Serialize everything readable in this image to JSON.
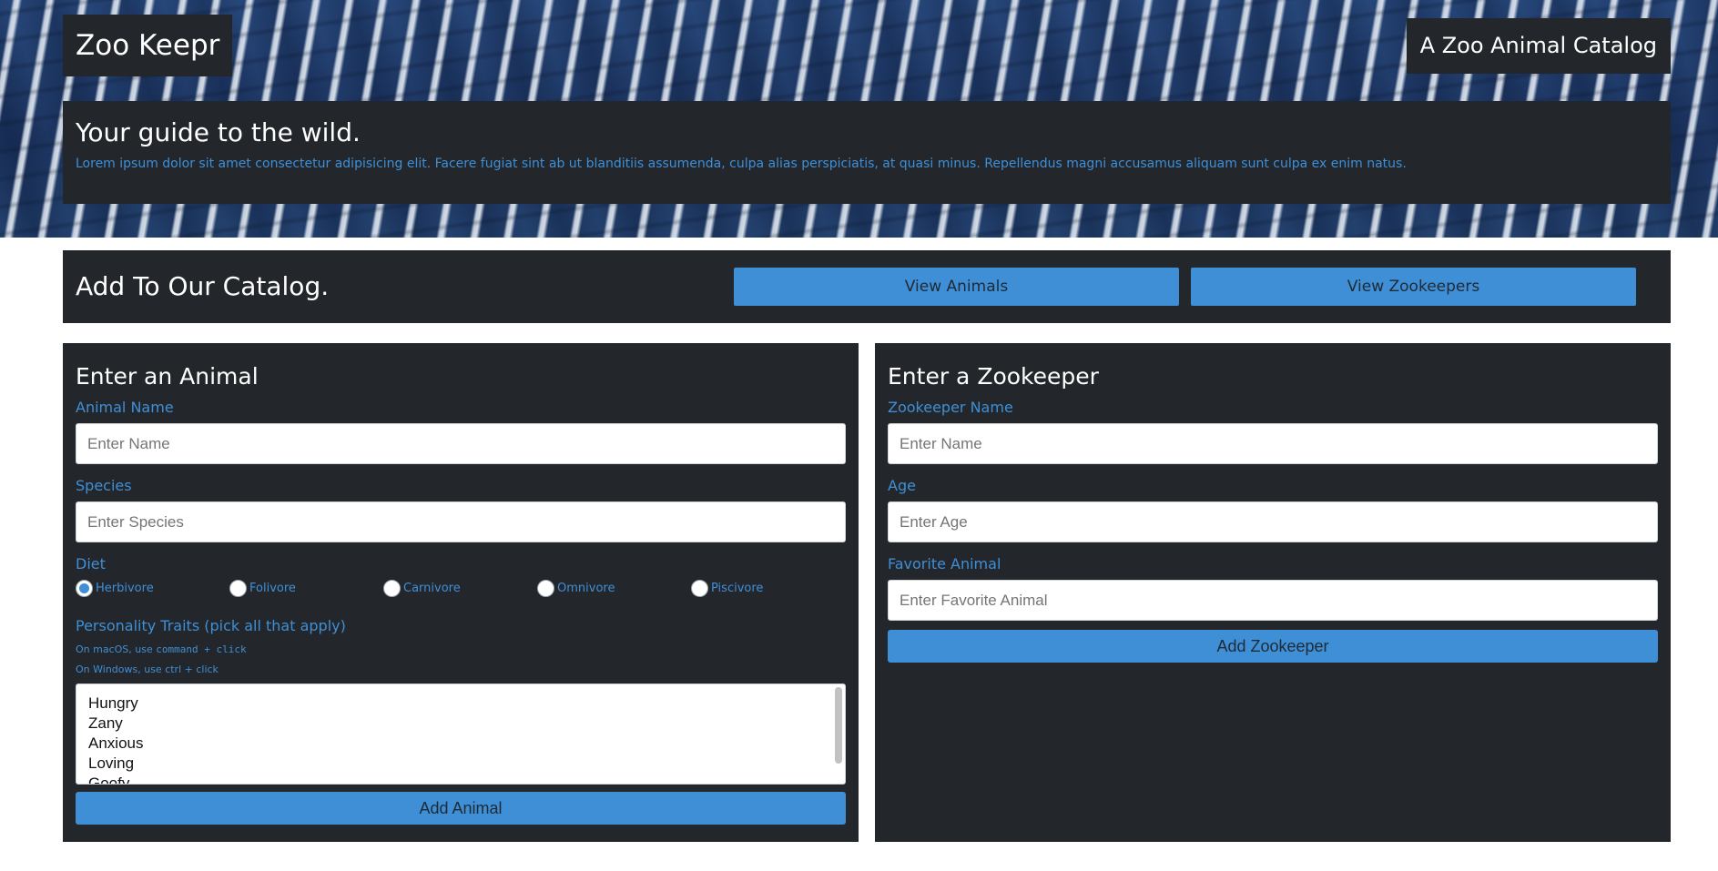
{
  "header": {
    "brand": "Zoo Keepr",
    "tagline": "A Zoo Animal Catalog"
  },
  "intro": {
    "title": "Your guide to the wild.",
    "text": "Lorem ipsum dolor sit amet consectetur adipisicing elit. Facere fugiat sint ab ut blanditiis assumenda, culpa alias perspiciatis, at quasi minus. Repellendus magni accusamus aliquam sunt culpa ex enim natus."
  },
  "catalog": {
    "title": "Add To Our Catalog.",
    "view_animals": "View Animals",
    "view_zookeepers": "View Zookeepers"
  },
  "animal_form": {
    "title": "Enter an Animal",
    "name_label": "Animal Name",
    "name_placeholder": "Enter Name",
    "species_label": "Species",
    "species_placeholder": "Enter Species",
    "diet_label": "Diet",
    "diet_options": [
      "Herbivore",
      "Folivore",
      "Carnivore",
      "Omnivore",
      "Piscivore"
    ],
    "diet_selected": "Herbivore",
    "traits_label": "Personality Traits (pick all that apply)",
    "hint_mac_prefix": "On macOS, use ",
    "hint_mac_code": "command + click",
    "hint_windows": "On Windows, use ctrl + click",
    "traits": [
      "Hungry",
      "Zany",
      "Anxious",
      "Loving",
      "Goofy"
    ],
    "submit": "Add Animal"
  },
  "keeper_form": {
    "title": "Enter a Zookeeper",
    "name_label": "Zookeeper Name",
    "name_placeholder": "Enter Name",
    "age_label": "Age",
    "age_placeholder": "Enter Age",
    "favorite_label": "Favorite Animal",
    "favorite_placeholder": "Enter Favorite Animal",
    "submit": "Add Zookeeper"
  },
  "colors": {
    "accent": "#3f8fd6",
    "panel": "#23272b"
  }
}
